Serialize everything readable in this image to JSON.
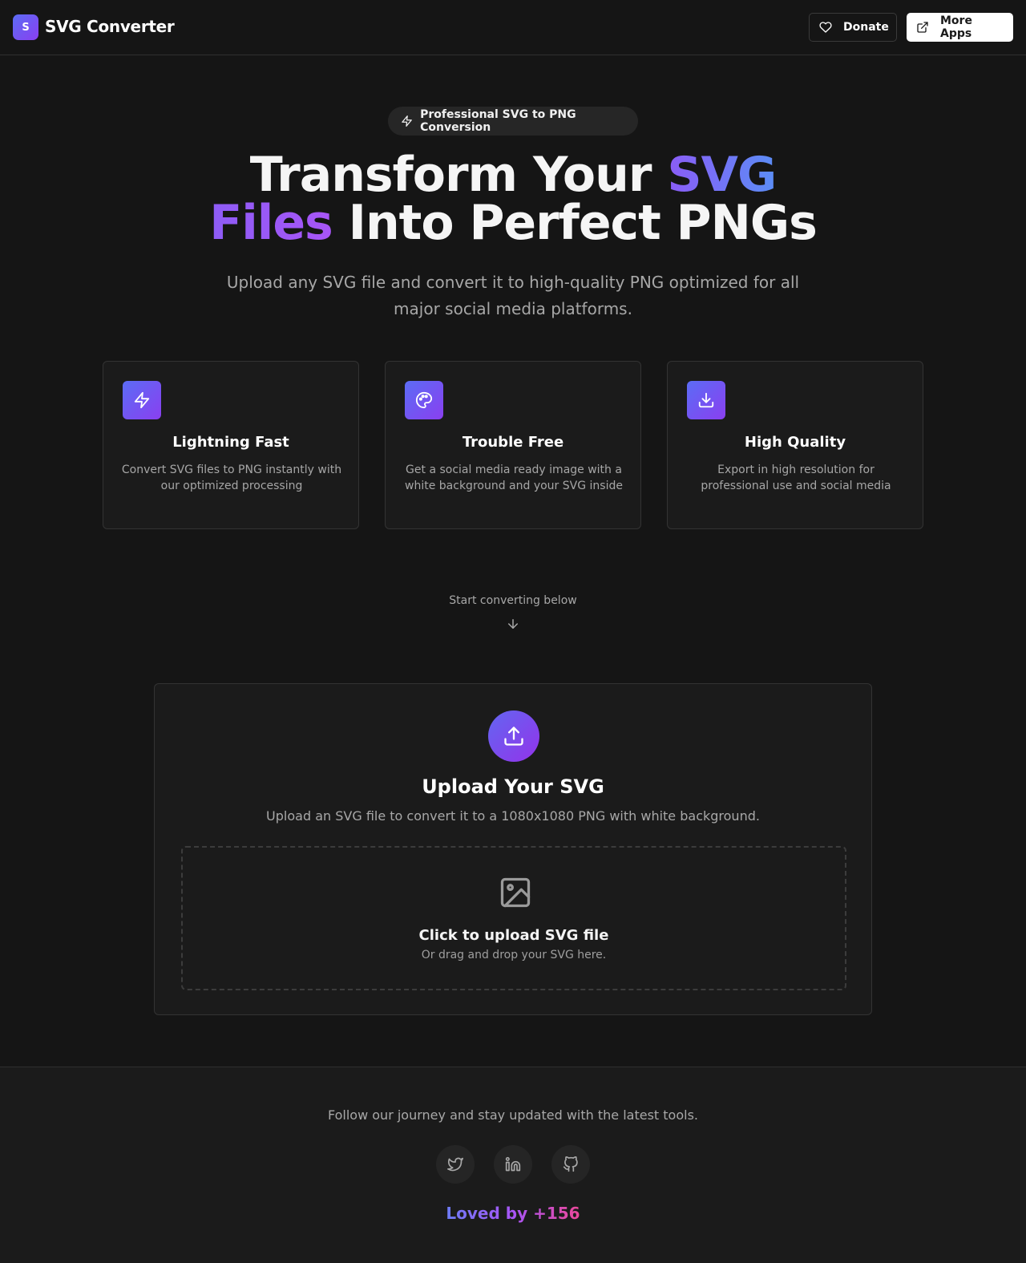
{
  "header": {
    "logo_letter": "S",
    "app_name": "SVG Converter",
    "donate_label": "Donate",
    "more_apps_label": "More Apps"
  },
  "hero": {
    "pill_label": "Professional SVG to PNG Conversion",
    "headline_part1": "Transform Your ",
    "headline_highlight1": "SVG",
    "headline_highlight2": "Files",
    "headline_part2": " Into Perfect PNGs",
    "subtitle": "Upload any SVG file and convert it to high-quality PNG optimized for all major social media platforms."
  },
  "features": [
    {
      "icon": "lightning-icon",
      "title": "Lightning Fast",
      "description": "Convert SVG files to PNG instantly with our optimized processing"
    },
    {
      "icon": "palette-icon",
      "title": "Trouble Free",
      "description": "Get a social media ready image with a white background and your SVG inside"
    },
    {
      "icon": "download-icon",
      "title": "High Quality",
      "description": "Export in high resolution for professional use and social media"
    }
  ],
  "start_hint": "Start converting below",
  "upload": {
    "title": "Upload Your SVG",
    "description": "Upload an SVG file to convert it to a 1080x1080 PNG with white background.",
    "dropzone_title": "Click to upload SVG file",
    "dropzone_subtitle": "Or drag and drop your SVG here."
  },
  "footer": {
    "text": "Follow our journey and stay updated with the latest tools.",
    "social": [
      "twitter-icon",
      "linkedin-icon",
      "github-icon"
    ],
    "loved_label": "Loved by +156"
  },
  "colors": {
    "background": "#151515",
    "accent_start": "#5b6cf5",
    "accent_end": "#8a3ff0"
  }
}
